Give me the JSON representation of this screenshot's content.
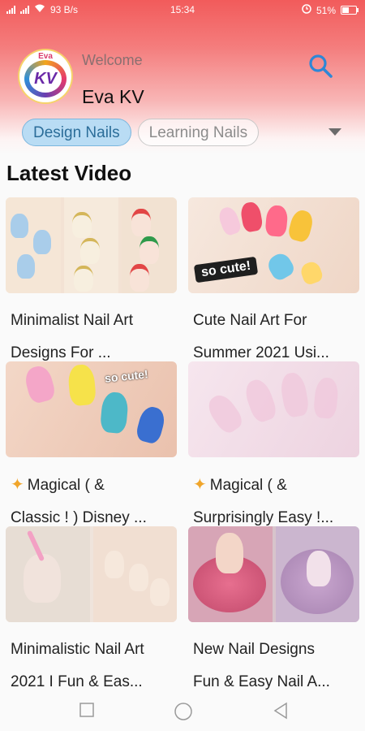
{
  "status_bar": {
    "network_speed": "93 B/s",
    "time": "15:34",
    "battery": "51%"
  },
  "header": {
    "logo_text_top": "Eva",
    "logo_text_main": "KV",
    "welcome": "Welcome",
    "username": "Eva KV",
    "search_icon": "search-icon"
  },
  "tabs": [
    {
      "label": "Design Nails",
      "active": true
    },
    {
      "label": "Learning Nails",
      "active": false
    }
  ],
  "section_title": "Latest Video",
  "videos": [
    {
      "line1": "Minimalist Nail Art",
      "line2": "Designs For ...",
      "sparkle": false
    },
    {
      "line1": "Cute Nail Art For",
      "line2": "Summer 2021 Usi...",
      "sparkle": false,
      "badge": "so cute!"
    },
    {
      "line1": "Magical ( &",
      "line2": "Classic ! ) Disney ...",
      "sparkle": true,
      "badge": "so cute!"
    },
    {
      "line1": "Magical ( &",
      "line2": "Surprisingly Easy !...",
      "sparkle": true
    },
    {
      "line1": "Minimalistic Nail Art",
      "line2": "2021 I Fun & Eas...",
      "sparkle": false
    },
    {
      "line1": "New Nail Designs",
      "line2": "Fun & Easy Nail A...",
      "sparkle": false
    }
  ],
  "colors": {
    "header_top": "#f25b5b",
    "chip_active_bg": "#b9dcf4",
    "chip_active_text": "#2b6d99",
    "search_icon": "#2f87d6"
  }
}
